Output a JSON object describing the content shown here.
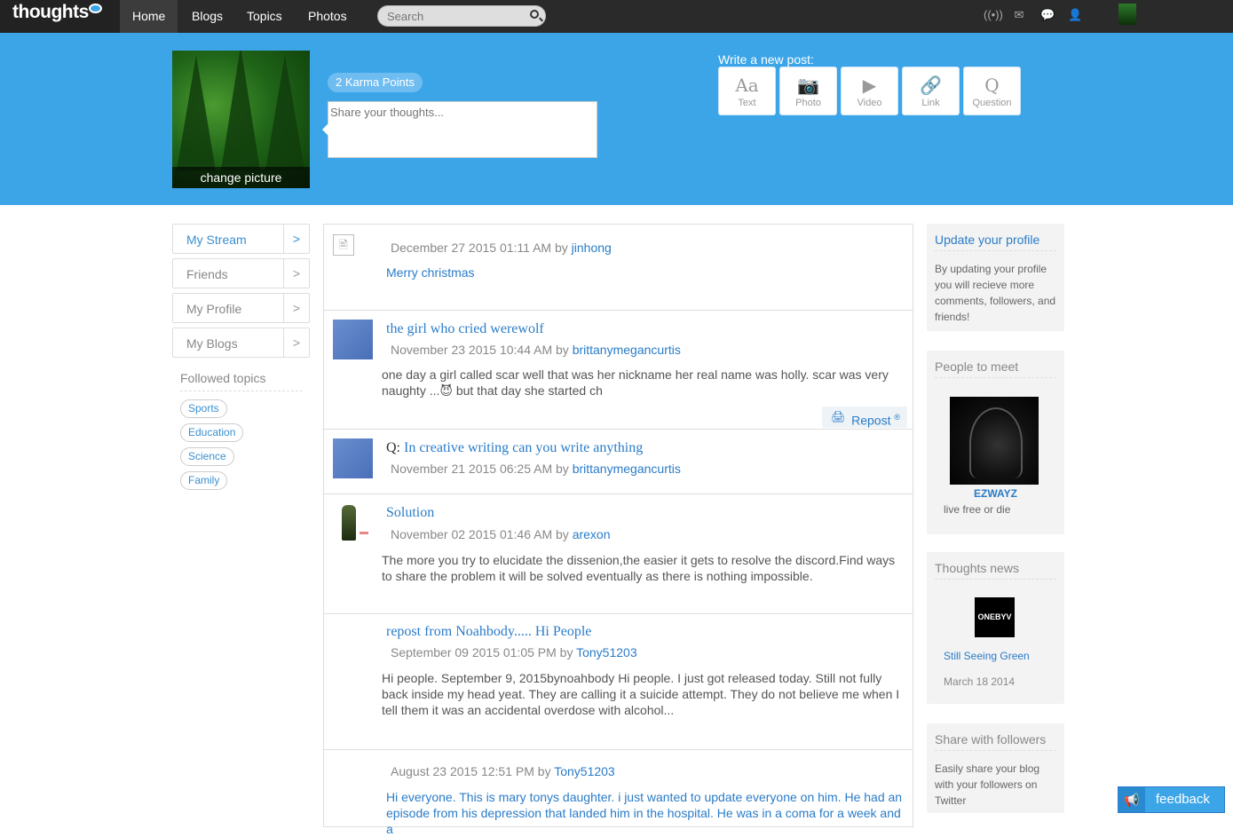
{
  "nav": {
    "logo": "thoughts",
    "tabs": [
      {
        "label": "Home"
      },
      {
        "label": "Blogs"
      },
      {
        "label": "Topics"
      },
      {
        "label": "Photos"
      }
    ],
    "search_placeholder": "Search",
    "icons": [
      "signal-icon",
      "mail-icon",
      "chat-icon",
      "user-icon"
    ]
  },
  "header": {
    "change_picture": "change picture",
    "karma": "2 Karma Points",
    "share_placeholder": "Share your thoughts...",
    "write_label": "Write a new post:",
    "post_types": [
      {
        "label": "Text",
        "glyph": "Aa"
      },
      {
        "label": "Photo",
        "glyph": "📷"
      },
      {
        "label": "Video",
        "glyph": "▶"
      },
      {
        "label": "Link",
        "glyph": "🔗"
      },
      {
        "label": "Question",
        "glyph": "Q"
      }
    ]
  },
  "sidebar": {
    "items": [
      {
        "label": "My Stream"
      },
      {
        "label": "Friends"
      },
      {
        "label": "My Profile"
      },
      {
        "label": "My Blogs"
      }
    ],
    "followed_title": "Followed topics",
    "topics": [
      "Sports",
      "Education",
      "Science",
      "Family"
    ]
  },
  "stream": {
    "posts": [
      {
        "title": "",
        "date": "December 27 2015 01:11 AM by ",
        "author": "jinhong",
        "body": "Merry christmas"
      },
      {
        "title": "the girl who cried werewolf",
        "date": "November 23 2015 10:44 AM by ",
        "author": "brittanymegancurtis",
        "body": "one day a girl called scar well that was her nickname her real name was holly. scar was very naughty ...😈 but that day she started ch",
        "repost": "Repost"
      },
      {
        "qprefix": "Q:",
        "title": "In creative writing can you write anything",
        "date": "November 21 2015 06:25 AM by ",
        "author": "brittanymegancurtis",
        "body": ""
      },
      {
        "title": "Solution",
        "date": "November 02 2015 01:46 AM by ",
        "author": "arexon",
        "body": "The more you try to elucidate the dissenion,the easier it gets to resolve the discord.Find ways to share the problem it will be solved eventually as there is nothing impossible."
      },
      {
        "title": "repost from Noahbody..... Hi People",
        "date": "September 09 2015 01:05 PM by ",
        "author": "Tony51203",
        "body": "Hi people. September 9, 2015bynoahbody Hi people. I just got released today. Still not fully back inside my head yeat. They are calling it a suicide attempt. They do not believe me when I tell them it was an accidental overdose with alcohol..."
      },
      {
        "title": "",
        "date": "August 23 2015 12:51 PM by ",
        "author": "Tony51203",
        "body": "Hi everyone. This is mary tonys daughter. i just wanted to update everyone on him. He had an episode from his depression that landed him in the hospital. He was in a coma for a week and a"
      }
    ]
  },
  "right": {
    "update_title": "Update your profile",
    "update_text": "By updating your profile you will recieve more comments, followers, and friends!",
    "meet_title": "People to meet",
    "meet_name": "EZWAYZ",
    "meet_tagline": "live free or die",
    "news_title": "Thoughts news",
    "news_thumb": "ONEBYV",
    "news_link": "Still Seeing Green",
    "news_date": "March 18 2014",
    "share_title": "Share with followers",
    "share_text": "Easily share your blog with your followers on Twitter"
  },
  "feedback": "feedback",
  "colors": {
    "brand_blue": "#3ba5e8",
    "link_blue": "#2a7cc8",
    "topbar": "#2a2a2a"
  }
}
